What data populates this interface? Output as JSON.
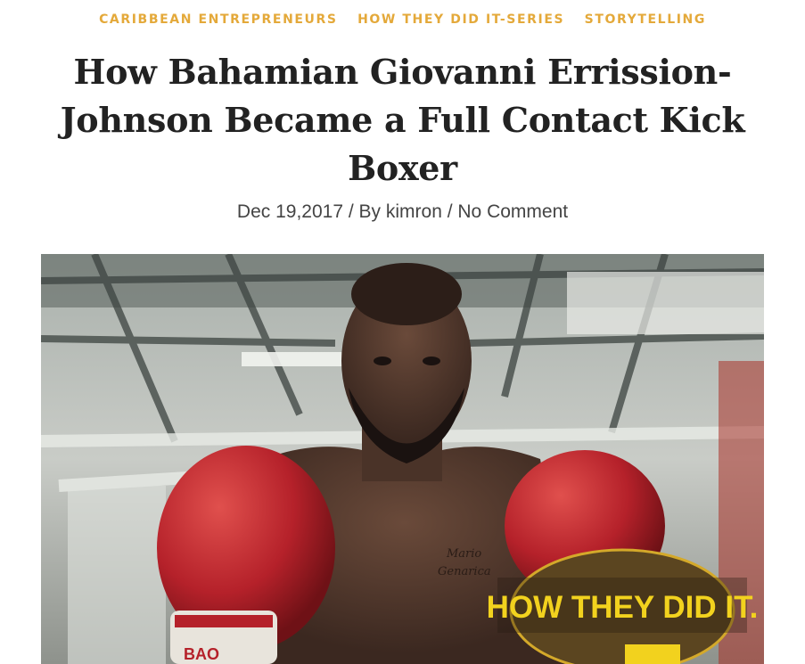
{
  "categories": [
    {
      "label": "CARIBBEAN ENTREPRENEURS"
    },
    {
      "label": "HOW THEY DID IT-SERIES"
    },
    {
      "label": "STORYTELLING"
    }
  ],
  "post": {
    "title": "How Bahamian Giovanni Errission-Johnson Became a Full Contact Kick Boxer",
    "date": "Dec 19,2017",
    "separator1": " / By ",
    "author": "kimron",
    "separator2": " / ",
    "comments": "No Comment"
  },
  "image": {
    "badge_text": "HOW THEY DID IT.",
    "tattoo_line1": "Mario",
    "tattoo_line2": "Genarica",
    "glove_text": "BAO"
  },
  "colors": {
    "category": "#e4a93a",
    "title": "#222222",
    "meta": "#444444",
    "badge_fill": "#f2d21e",
    "badge_bg": "#5b4520"
  }
}
